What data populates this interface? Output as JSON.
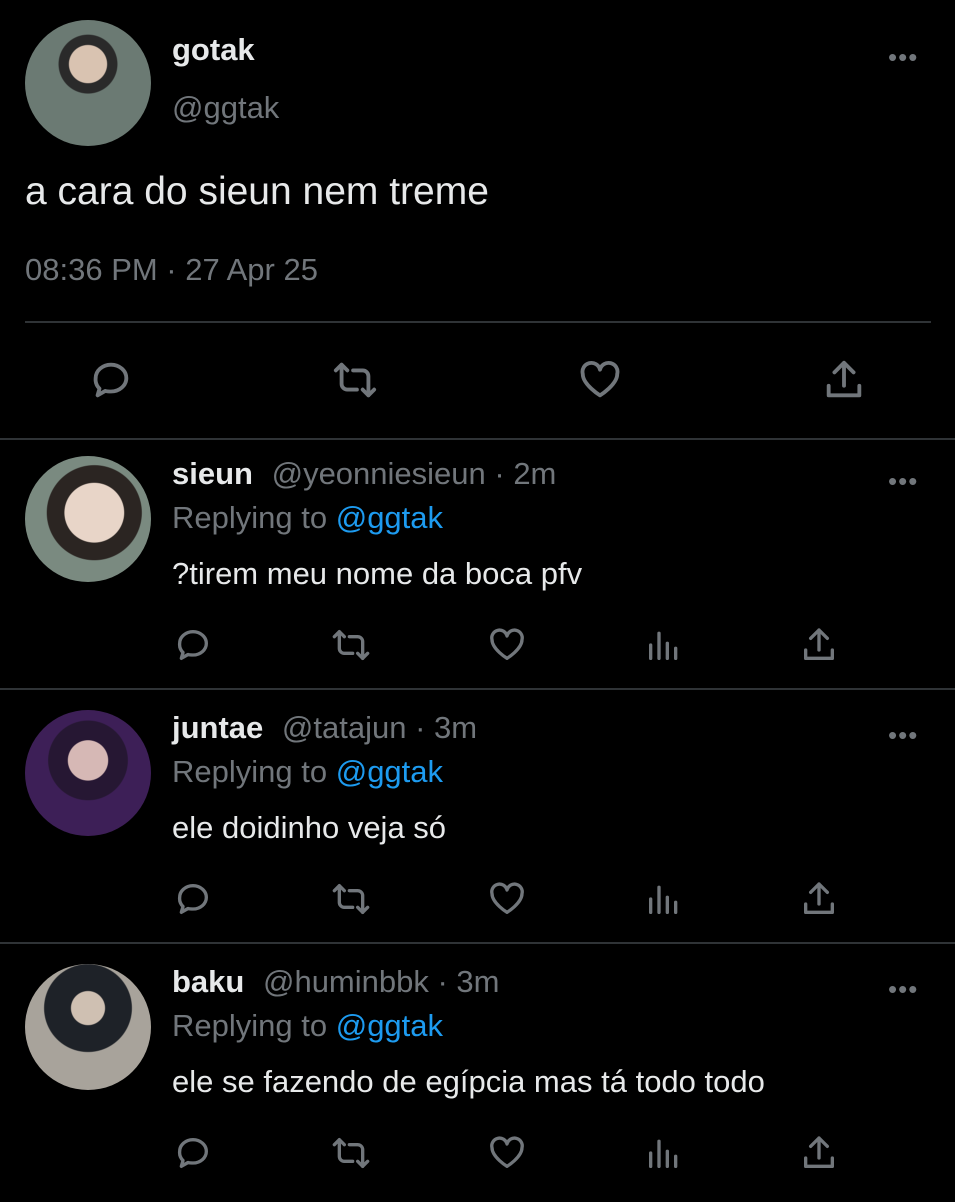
{
  "main": {
    "display_name": "gotak",
    "handle": "@ggtak",
    "text": "a cara do sieun nem treme",
    "timestamp": "08:36 PM · 27 Apr 25",
    "more": "•••"
  },
  "replies": [
    {
      "display_name": "sieun",
      "handle": "@yeonniesieun",
      "time": " · 2m",
      "replying_prefix": "Replying to ",
      "replying_to": "@ggtak",
      "text": "?tirem meu nome da boca pfv",
      "more": "•••"
    },
    {
      "display_name": "juntae",
      "handle": "@tatajun",
      "time": " · 3m",
      "replying_prefix": "Replying to ",
      "replying_to": "@ggtak",
      "text": "ele doidinho veja só",
      "more": "•••"
    },
    {
      "display_name": "baku",
      "handle": "@huminbbk",
      "time": " · 3m",
      "replying_prefix": "Replying to ",
      "replying_to": "@ggtak",
      "text": "ele se fazendo de egípcia mas tá todo todo",
      "more": "•••"
    }
  ],
  "colors": {
    "background": "#000000",
    "text": "#e7e9ea",
    "muted": "#71767b",
    "link": "#1d9bf0",
    "divider": "#2f3336"
  },
  "icons": [
    "reply-icon",
    "retweet-icon",
    "like-icon",
    "analytics-icon",
    "share-icon",
    "more-icon"
  ]
}
